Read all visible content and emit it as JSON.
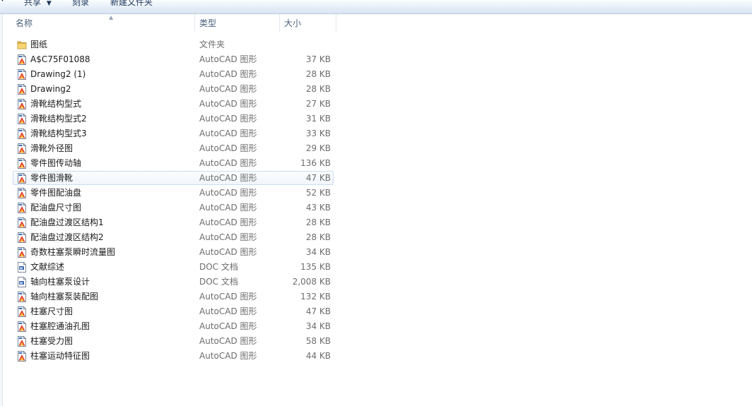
{
  "toolbar": {
    "share_label": "共享",
    "burn_label": "刻录",
    "new_folder_label": "新建文件夹"
  },
  "columns": {
    "name": "名称",
    "type": "类型",
    "size": "大小"
  },
  "files": [
    {
      "name": "图纸",
      "type": "文件夹",
      "size": "",
      "icon": "folder-icon"
    },
    {
      "name": "A$C75F01088",
      "type": "AutoCAD 图形",
      "size": "37 KB",
      "icon": "autocad-file-icon"
    },
    {
      "name": "Drawing2 (1)",
      "type": "AutoCAD 图形",
      "size": "28 KB",
      "icon": "autocad-file-icon"
    },
    {
      "name": "Drawing2",
      "type": "AutoCAD 图形",
      "size": "28 KB",
      "icon": "autocad-file-icon"
    },
    {
      "name": "滑靴结构型式",
      "type": "AutoCAD 图形",
      "size": "27 KB",
      "icon": "autocad-file-icon"
    },
    {
      "name": "滑靴结构型式2",
      "type": "AutoCAD 图形",
      "size": "31 KB",
      "icon": "autocad-file-icon"
    },
    {
      "name": "滑靴结构型式3",
      "type": "AutoCAD 图形",
      "size": "33 KB",
      "icon": "autocad-file-icon"
    },
    {
      "name": "滑靴外径图",
      "type": "AutoCAD 图形",
      "size": "29 KB",
      "icon": "autocad-file-icon"
    },
    {
      "name": "零件图传动轴",
      "type": "AutoCAD 图形",
      "size": "136 KB",
      "icon": "autocad-file-icon"
    },
    {
      "name": "零件图滑靴",
      "type": "AutoCAD 图形",
      "size": "47 KB",
      "icon": "autocad-file-icon",
      "selected": true
    },
    {
      "name": "零件图配油盘",
      "type": "AutoCAD 图形",
      "size": "52 KB",
      "icon": "autocad-file-icon"
    },
    {
      "name": "配油盘尺寸图",
      "type": "AutoCAD 图形",
      "size": "43 KB",
      "icon": "autocad-file-icon"
    },
    {
      "name": "配油盘过渡区结构1",
      "type": "AutoCAD 图形",
      "size": "28 KB",
      "icon": "autocad-file-icon"
    },
    {
      "name": "配油盘过渡区结构2",
      "type": "AutoCAD 图形",
      "size": "28 KB",
      "icon": "autocad-file-icon"
    },
    {
      "name": "奇数柱塞泵瞬时流量图",
      "type": "AutoCAD 图形",
      "size": "34 KB",
      "icon": "autocad-file-icon"
    },
    {
      "name": "文献综述",
      "type": "DOC 文档",
      "size": "135 KB",
      "icon": "doc-file-icon"
    },
    {
      "name": "轴向柱塞泵设计",
      "type": "DOC 文档",
      "size": "2,008 KB",
      "icon": "doc-file-icon"
    },
    {
      "name": "轴向柱塞泵装配图",
      "type": "AutoCAD 图形",
      "size": "132 KB",
      "icon": "autocad-file-icon"
    },
    {
      "name": "柱塞尺寸图",
      "type": "AutoCAD 图形",
      "size": "47 KB",
      "icon": "autocad-file-icon"
    },
    {
      "name": "柱塞腔通油孔图",
      "type": "AutoCAD 图形",
      "size": "34 KB",
      "icon": "autocad-file-icon"
    },
    {
      "name": "柱塞受力图",
      "type": "AutoCAD 图形",
      "size": "58 KB",
      "icon": "autocad-file-icon"
    },
    {
      "name": "柱塞运动特征图",
      "type": "AutoCAD 图形",
      "size": "44 KB",
      "icon": "autocad-file-icon"
    }
  ],
  "colors": {
    "selection_border": "#c9dcf2",
    "toolbar_text": "#1e395b",
    "secondary_text": "#6d6d6d"
  }
}
